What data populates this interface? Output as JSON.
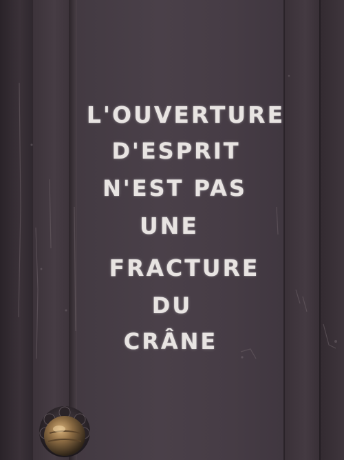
{
  "graffiti": {
    "lines": [
      "L'OUVERTURE",
      "D'ESPRIT",
      "N'EST PAS",
      "UNE",
      "FRACTURE",
      "DU",
      "CRÂNE"
    ]
  },
  "colors": {
    "door": "#433a42",
    "paint": "#e8e4e2",
    "knob": "#8a6a42"
  },
  "icons": {
    "knob": "door-knob-icon"
  }
}
